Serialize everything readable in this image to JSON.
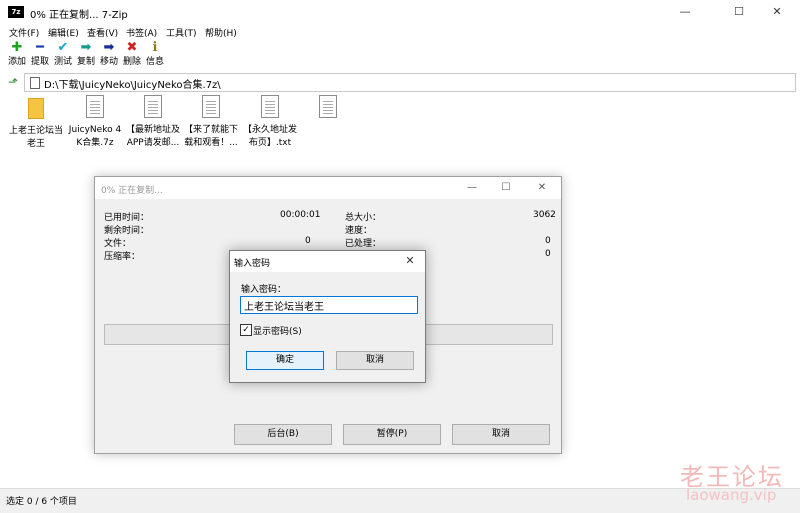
{
  "window": {
    "app_icon_text": "7z",
    "title": "0% 正在复制... 7-Zip",
    "minimize": "—",
    "maximize": "☐",
    "close": "✕"
  },
  "menu": [
    "文件(F)",
    "编辑(E)",
    "查看(V)",
    "书签(A)",
    "工具(T)",
    "帮助(H)"
  ],
  "toolbar": [
    {
      "label": "添加",
      "icon": "plus-icon",
      "glyph": "✚",
      "color": "#19a319"
    },
    {
      "label": "提取",
      "icon": "minus-icon",
      "glyph": "━",
      "color": "#1a3fb5"
    },
    {
      "label": "测试",
      "icon": "check-icon",
      "glyph": "✔",
      "color": "#1aa3c9"
    },
    {
      "label": "复制",
      "icon": "copy-arrow-icon",
      "glyph": "➡",
      "color": "#1a9a8a"
    },
    {
      "label": "移动",
      "icon": "move-arrow-icon",
      "glyph": "➡",
      "color": "#1a2f9a"
    },
    {
      "label": "删除",
      "icon": "delete-icon",
      "glyph": "✖",
      "color": "#d42020"
    },
    {
      "label": "信息",
      "icon": "info-icon",
      "glyph": "ℹ",
      "color": "#8a7a1a"
    }
  ],
  "address": {
    "path": "D:\\下载\\JuicyNeko\\JuicyNeko合集.7z\\"
  },
  "files": [
    {
      "name": "上老王论坛当老王",
      "type": "folder"
    },
    {
      "name": "JuicyNeko 4K合集.7z",
      "type": "file"
    },
    {
      "name": "【最新地址及APP请发邮...",
      "type": "file"
    },
    {
      "name": "【来了就能下载和观看！...",
      "type": "file"
    },
    {
      "name": "【永久地址发布页】.txt",
      "type": "file"
    },
    {
      "name": "",
      "type": "file"
    }
  ],
  "status": {
    "text": "选定 0 / 6 个项目"
  },
  "progress_dialog": {
    "title": "0% 正在复制...",
    "left_stats": [
      {
        "label": "已用时间：",
        "value": "00:00:01"
      },
      {
        "label": "剩余时间：",
        "value": ""
      },
      {
        "label": "文件：",
        "value": "0"
      },
      {
        "label": "压缩率：",
        "value": ""
      }
    ],
    "right_stats": [
      {
        "label": "总大小：",
        "value": "3062"
      },
      {
        "label": "速度：",
        "value": ""
      },
      {
        "label": "已处理：",
        "value": "0"
      },
      {
        "label": "",
        "value": "0"
      }
    ],
    "progress": 0,
    "buttons": [
      "后台(B)",
      "暂停(P)",
      "取消"
    ]
  },
  "password_dialog": {
    "title": "输入密码",
    "label": "输入密码：",
    "value": "上老王论坛当老王",
    "checkbox_label": "显示密码(S)",
    "checkbox_checked": true,
    "ok": "确定",
    "cancel": "取消"
  },
  "watermark": {
    "cn": "老王论坛",
    "en": "laowang.vip"
  }
}
